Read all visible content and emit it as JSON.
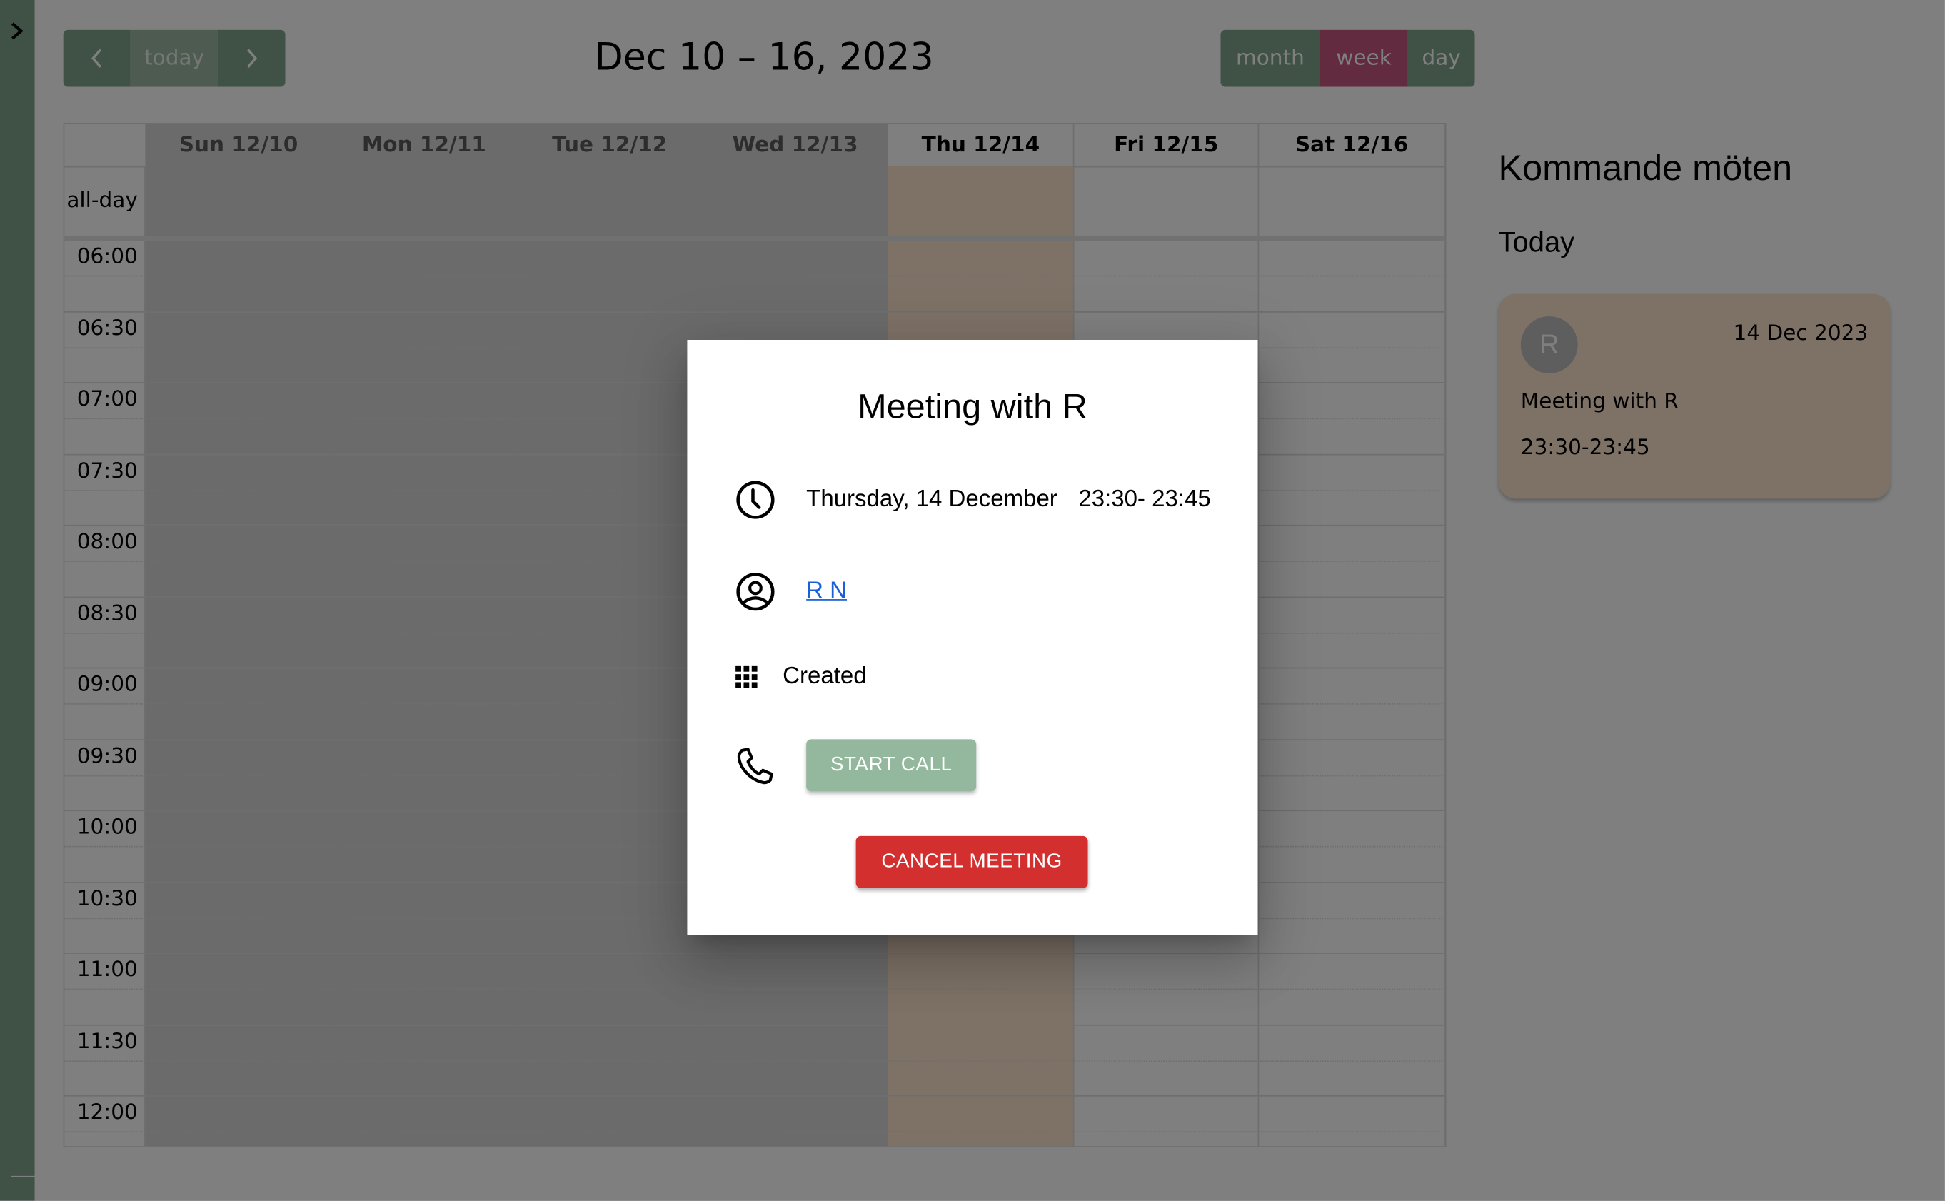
{
  "sidebar": {
    "toggle_icon": "chevron-right-icon"
  },
  "toolbar": {
    "prev_icon": "chevron-left-icon",
    "today_label": "today",
    "next_icon": "chevron-right-icon",
    "title": "Dec 10 – 16, 2023",
    "views": [
      {
        "label": "month",
        "active": false
      },
      {
        "label": "week",
        "active": true
      },
      {
        "label": "day",
        "active": false
      }
    ]
  },
  "colors": {
    "primary_green": "#80a58a",
    "active_view": "#c4567f",
    "today_column": "#fde4cf",
    "start_call": "#93b89e",
    "cancel": "#d32f2f",
    "link": "#1a5fd8"
  },
  "calendar": {
    "allday_label": "all-day",
    "days": [
      {
        "label": "Sun 12/10",
        "state": "past"
      },
      {
        "label": "Mon 12/11",
        "state": "past"
      },
      {
        "label": "Tue 12/12",
        "state": "past"
      },
      {
        "label": "Wed 12/13",
        "state": "past"
      },
      {
        "label": "Thu 12/14",
        "state": "today"
      },
      {
        "label": "Fri 12/15",
        "state": "future"
      },
      {
        "label": "Sat 12/16",
        "state": "future"
      }
    ],
    "time_slots": [
      "06:00",
      "06:30",
      "07:00",
      "07:30",
      "08:00",
      "08:30",
      "09:00",
      "09:30",
      "10:00",
      "10:30",
      "11:00",
      "11:30",
      "12:00"
    ]
  },
  "upcoming": {
    "title": "Kommande möten",
    "section": "Today",
    "meetings": [
      {
        "avatar_letter": "R",
        "date": "14 Dec 2023",
        "title": "Meeting with R",
        "time": "23:30-23:45"
      }
    ]
  },
  "modal": {
    "title": "Meeting with R",
    "date": "Thursday, 14 December",
    "time": "23:30- 23:45",
    "participant": "R N",
    "status": "Created",
    "start_call_label": "START CALL",
    "cancel_label": "CANCEL MEETING",
    "icons": {
      "time": "clock-icon",
      "participant": "user-circle-icon",
      "status": "grid-icon",
      "call": "phone-icon"
    }
  }
}
